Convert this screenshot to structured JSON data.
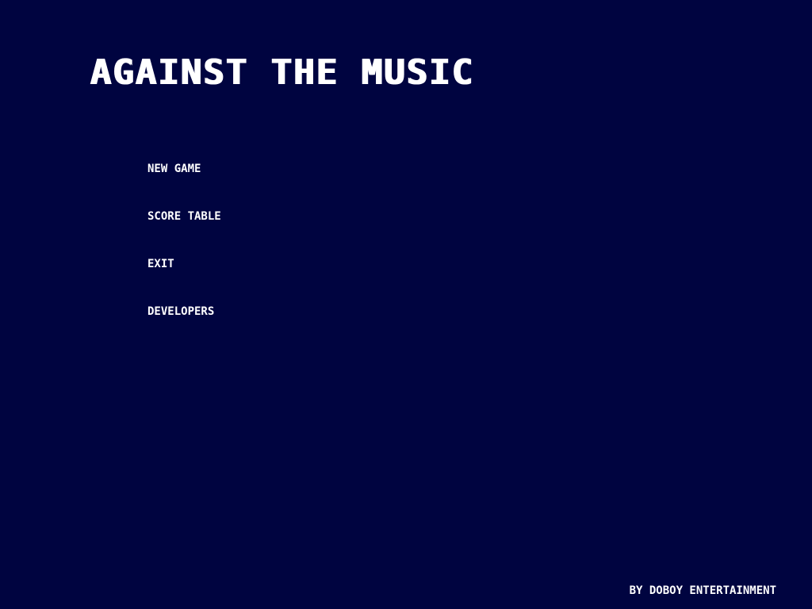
{
  "game": {
    "title": "AGAINST THE MUSIC",
    "menu": [
      {
        "label": "NEW GAME"
      },
      {
        "label": "SCORE TABLE"
      },
      {
        "label": "EXIT"
      },
      {
        "label": "DEVELOPERS"
      }
    ],
    "credit": "BY DOBOY ENTERTAINMENT"
  },
  "colors": {
    "background": "#000440",
    "text": "#ffffff"
  }
}
